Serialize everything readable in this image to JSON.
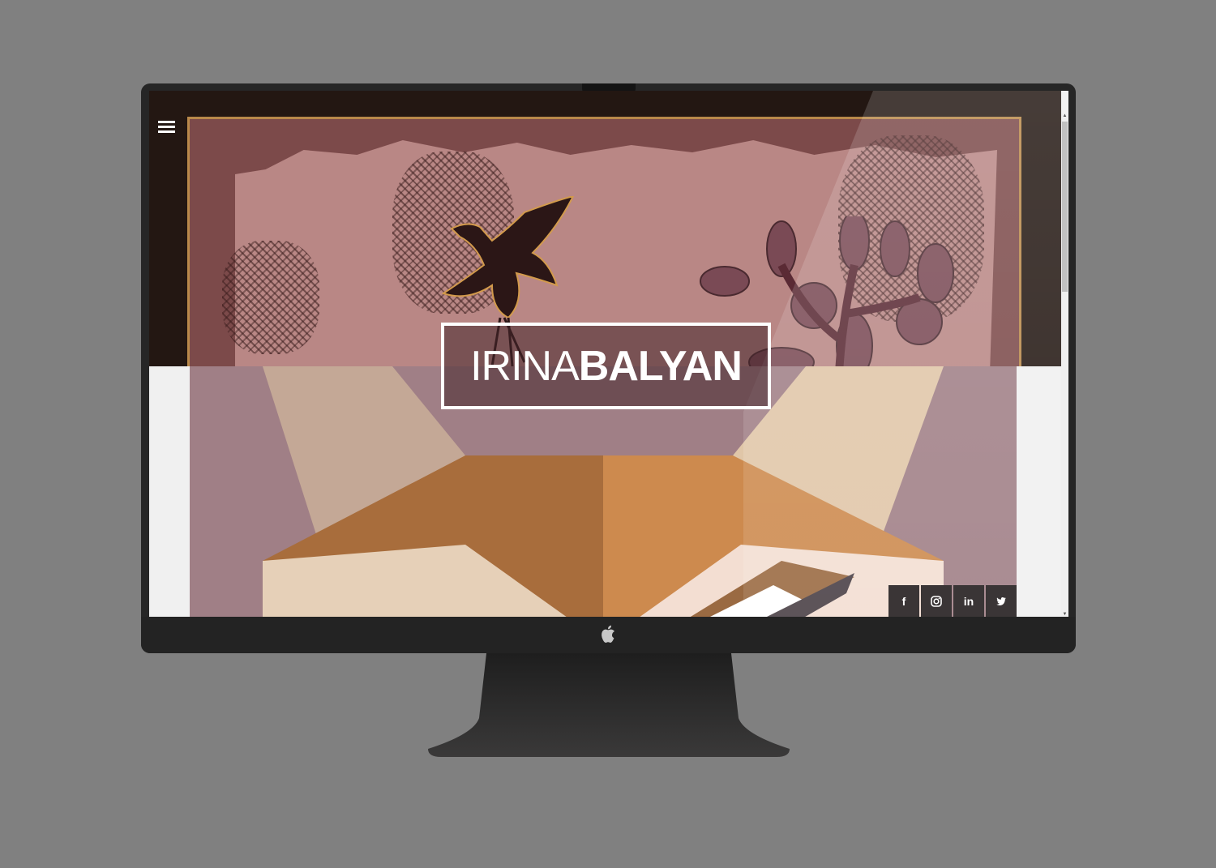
{
  "site": {
    "logo_light": "IRINA",
    "logo_bold": "BALYAN"
  },
  "menu": {
    "icon": "hamburger-menu-icon"
  },
  "social": [
    {
      "name": "facebook",
      "glyph": "f",
      "icon": "facebook-icon"
    },
    {
      "name": "instagram",
      "glyph": "",
      "icon": "instagram-icon"
    },
    {
      "name": "linkedin",
      "glyph": "in",
      "icon": "linkedin-icon"
    },
    {
      "name": "twitter",
      "glyph": "",
      "icon": "twitter-icon"
    }
  ],
  "colors": {
    "page_background": "#808080",
    "monitor_bezel": "#262626",
    "hero_dark": "#231712",
    "fabric_red": "#7c4a4a",
    "gold_frame": "#b9894a",
    "fox_orange": "#c98a4e",
    "fox_pink_bg": "#a07f86",
    "social_button": "#3a3536"
  }
}
